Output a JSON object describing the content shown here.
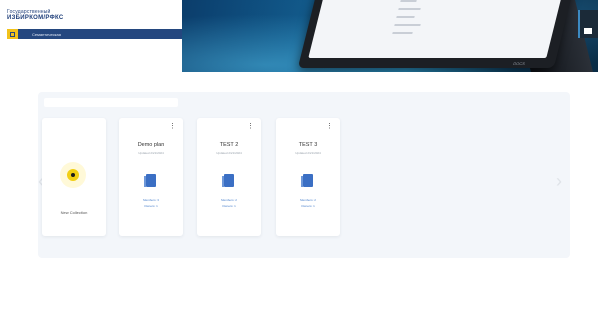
{
  "brand": {
    "line1": "Государственный",
    "line2": "ИЗБИРКОМ/РФКС"
  },
  "org_bar": {
    "name": "Семантическая"
  },
  "hero": {
    "tablet_logo": "DOCS"
  },
  "collections": {
    "new_label": "New Collection",
    "cards": [
      {
        "title": "Demo plan",
        "subtitle": "Updated 2/21/2024",
        "meta1": "Members: 3",
        "meta2": "Owners: 1"
      },
      {
        "title": "TEST 2",
        "subtitle": "Updated 2/21/2024",
        "meta1": "Members: 2",
        "meta2": "Owners: 1"
      },
      {
        "title": "TEST 3",
        "subtitle": "Updated 2/21/2024",
        "meta1": "Members: 2",
        "meta2": "Owners: 1"
      }
    ],
    "menu_glyph": "⋮",
    "prev_arrow": "‹",
    "next_arrow": "›"
  },
  "colors": {
    "brand_blue": "#24477f",
    "accent_yellow": "#f2cf14",
    "link_blue": "#4a80cc"
  },
  "icons": [
    "grid-icon",
    "plus-icon",
    "folder-icon",
    "more-vertical-icon",
    "chevron-left-icon",
    "chevron-right-icon"
  ]
}
